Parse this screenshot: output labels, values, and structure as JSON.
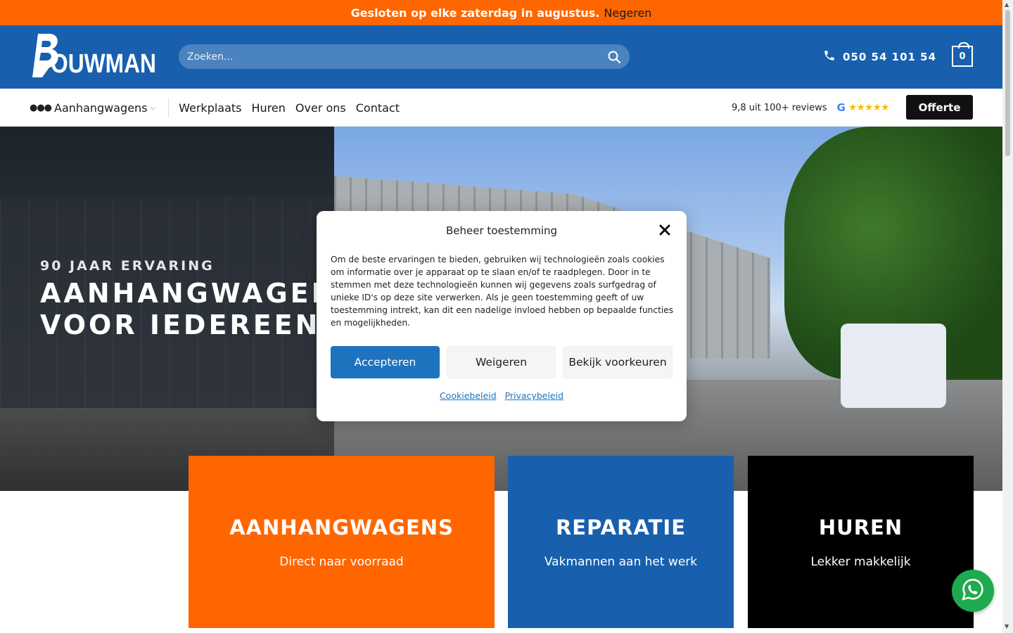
{
  "notice": {
    "message": "Gesloten op elke zaterdag in augustus.",
    "dismiss_label": "Negeren"
  },
  "header": {
    "logo_text": "BOUWMAN",
    "search_placeholder": "Zoeken...",
    "phone": "050 54 101 54",
    "cart_count": "0",
    "brand_color": "#1860ae",
    "accent_color": "#ff6600"
  },
  "nav": {
    "items": [
      {
        "label": "Aanhangwagens",
        "has_dropdown": true
      },
      {
        "label": "Werkplaats"
      },
      {
        "label": "Huren"
      },
      {
        "label": "Over ons"
      },
      {
        "label": "Contact"
      }
    ],
    "reviews_text": "9,8 uit 100+ reviews",
    "google_letter": "G",
    "stars": "★★★★★",
    "cta_label": "Offerte"
  },
  "hero": {
    "kicker": "90 JAAR ERVARING",
    "title_line1": "AANHANGWAGENS",
    "title_line2": "VOOR IEDEREEN"
  },
  "categories": [
    {
      "title": "AANHANGWAGENS",
      "subtitle": "Direct naar voorraad",
      "color": "#ff6600"
    },
    {
      "title": "REPARATIE",
      "subtitle": "Vakmannen aan het werk",
      "color": "#1860ae"
    },
    {
      "title": "HUREN",
      "subtitle": "Lekker makkelijk",
      "color": "#000000"
    }
  ],
  "cookie_modal": {
    "title": "Beheer toestemming",
    "body": "Om de beste ervaringen te bieden, gebruiken wij technologieën zoals cookies om informatie over je apparaat op te slaan en/of te raadplegen. Door in te stemmen met deze technologieën kunnen wij gegevens zoals surfgedrag of unieke ID's op deze site verwerken. Als je geen toestemming geeft of uw toestemming intrekt, kan dit een nadelige invloed hebben op bepaalde functies en mogelijkheden.",
    "accept_label": "Accepteren",
    "deny_label": "Weigeren",
    "prefs_label": "Bekijk voorkeuren",
    "cookie_policy_label": "Cookiebeleid",
    "privacy_policy_label": "Privacybeleid"
  }
}
